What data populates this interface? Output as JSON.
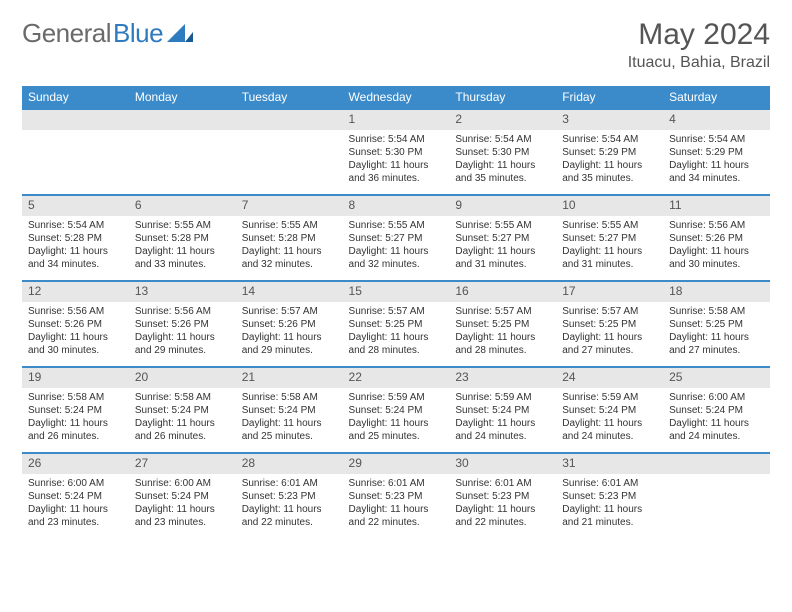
{
  "logo": {
    "part1": "General",
    "part2": "Blue"
  },
  "title": "May 2024",
  "subtitle": "Ituacu, Bahia, Brazil",
  "weekdays": [
    "Sunday",
    "Monday",
    "Tuesday",
    "Wednesday",
    "Thursday",
    "Friday",
    "Saturday"
  ],
  "labels": {
    "sunrise": "Sunrise:",
    "sunset": "Sunset:",
    "daylight": "Daylight:"
  },
  "weeks": [
    [
      null,
      null,
      null,
      {
        "d": "1",
        "sunrise": "5:54 AM",
        "sunset": "5:30 PM",
        "daylight": "11 hours and 36 minutes."
      },
      {
        "d": "2",
        "sunrise": "5:54 AM",
        "sunset": "5:30 PM",
        "daylight": "11 hours and 35 minutes."
      },
      {
        "d": "3",
        "sunrise": "5:54 AM",
        "sunset": "5:29 PM",
        "daylight": "11 hours and 35 minutes."
      },
      {
        "d": "4",
        "sunrise": "5:54 AM",
        "sunset": "5:29 PM",
        "daylight": "11 hours and 34 minutes."
      }
    ],
    [
      {
        "d": "5",
        "sunrise": "5:54 AM",
        "sunset": "5:28 PM",
        "daylight": "11 hours and 34 minutes."
      },
      {
        "d": "6",
        "sunrise": "5:55 AM",
        "sunset": "5:28 PM",
        "daylight": "11 hours and 33 minutes."
      },
      {
        "d": "7",
        "sunrise": "5:55 AM",
        "sunset": "5:28 PM",
        "daylight": "11 hours and 32 minutes."
      },
      {
        "d": "8",
        "sunrise": "5:55 AM",
        "sunset": "5:27 PM",
        "daylight": "11 hours and 32 minutes."
      },
      {
        "d": "9",
        "sunrise": "5:55 AM",
        "sunset": "5:27 PM",
        "daylight": "11 hours and 31 minutes."
      },
      {
        "d": "10",
        "sunrise": "5:55 AM",
        "sunset": "5:27 PM",
        "daylight": "11 hours and 31 minutes."
      },
      {
        "d": "11",
        "sunrise": "5:56 AM",
        "sunset": "5:26 PM",
        "daylight": "11 hours and 30 minutes."
      }
    ],
    [
      {
        "d": "12",
        "sunrise": "5:56 AM",
        "sunset": "5:26 PM",
        "daylight": "11 hours and 30 minutes."
      },
      {
        "d": "13",
        "sunrise": "5:56 AM",
        "sunset": "5:26 PM",
        "daylight": "11 hours and 29 minutes."
      },
      {
        "d": "14",
        "sunrise": "5:57 AM",
        "sunset": "5:26 PM",
        "daylight": "11 hours and 29 minutes."
      },
      {
        "d": "15",
        "sunrise": "5:57 AM",
        "sunset": "5:25 PM",
        "daylight": "11 hours and 28 minutes."
      },
      {
        "d": "16",
        "sunrise": "5:57 AM",
        "sunset": "5:25 PM",
        "daylight": "11 hours and 28 minutes."
      },
      {
        "d": "17",
        "sunrise": "5:57 AM",
        "sunset": "5:25 PM",
        "daylight": "11 hours and 27 minutes."
      },
      {
        "d": "18",
        "sunrise": "5:58 AM",
        "sunset": "5:25 PM",
        "daylight": "11 hours and 27 minutes."
      }
    ],
    [
      {
        "d": "19",
        "sunrise": "5:58 AM",
        "sunset": "5:24 PM",
        "daylight": "11 hours and 26 minutes."
      },
      {
        "d": "20",
        "sunrise": "5:58 AM",
        "sunset": "5:24 PM",
        "daylight": "11 hours and 26 minutes."
      },
      {
        "d": "21",
        "sunrise": "5:58 AM",
        "sunset": "5:24 PM",
        "daylight": "11 hours and 25 minutes."
      },
      {
        "d": "22",
        "sunrise": "5:59 AM",
        "sunset": "5:24 PM",
        "daylight": "11 hours and 25 minutes."
      },
      {
        "d": "23",
        "sunrise": "5:59 AM",
        "sunset": "5:24 PM",
        "daylight": "11 hours and 24 minutes."
      },
      {
        "d": "24",
        "sunrise": "5:59 AM",
        "sunset": "5:24 PM",
        "daylight": "11 hours and 24 minutes."
      },
      {
        "d": "25",
        "sunrise": "6:00 AM",
        "sunset": "5:24 PM",
        "daylight": "11 hours and 24 minutes."
      }
    ],
    [
      {
        "d": "26",
        "sunrise": "6:00 AM",
        "sunset": "5:24 PM",
        "daylight": "11 hours and 23 minutes."
      },
      {
        "d": "27",
        "sunrise": "6:00 AM",
        "sunset": "5:24 PM",
        "daylight": "11 hours and 23 minutes."
      },
      {
        "d": "28",
        "sunrise": "6:01 AM",
        "sunset": "5:23 PM",
        "daylight": "11 hours and 22 minutes."
      },
      {
        "d": "29",
        "sunrise": "6:01 AM",
        "sunset": "5:23 PM",
        "daylight": "11 hours and 22 minutes."
      },
      {
        "d": "30",
        "sunrise": "6:01 AM",
        "sunset": "5:23 PM",
        "daylight": "11 hours and 22 minutes."
      },
      {
        "d": "31",
        "sunrise": "6:01 AM",
        "sunset": "5:23 PM",
        "daylight": "11 hours and 21 minutes."
      },
      null
    ]
  ]
}
